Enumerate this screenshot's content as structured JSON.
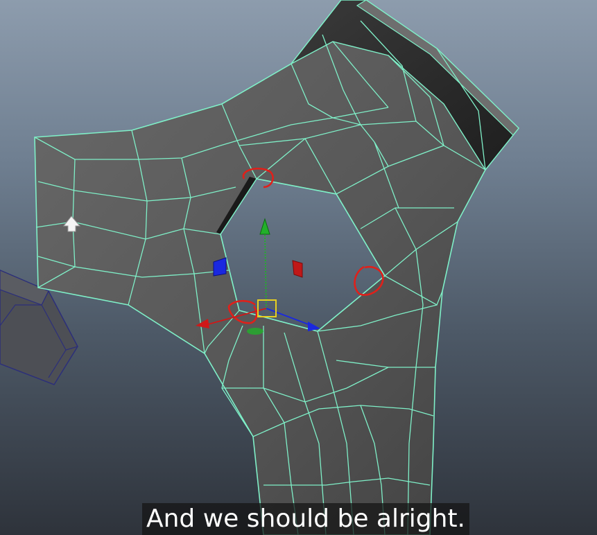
{
  "viewport": {
    "background_top": "#8d9cad",
    "background_bottom": "#2e333b",
    "mesh_fill": "#5c5c5c",
    "mesh_dark_fill": "#2a2a2a",
    "wireframe_color": "#7ff0c8",
    "annotation_color": "#e0201a",
    "manipulator": {
      "x_axis_color": "#d01818",
      "y_axis_color": "#22b02a",
      "z_axis_color": "#1a28e0",
      "center_handle_color": "#e8d020"
    }
  },
  "subtitle": {
    "text": "And we should be alright."
  }
}
